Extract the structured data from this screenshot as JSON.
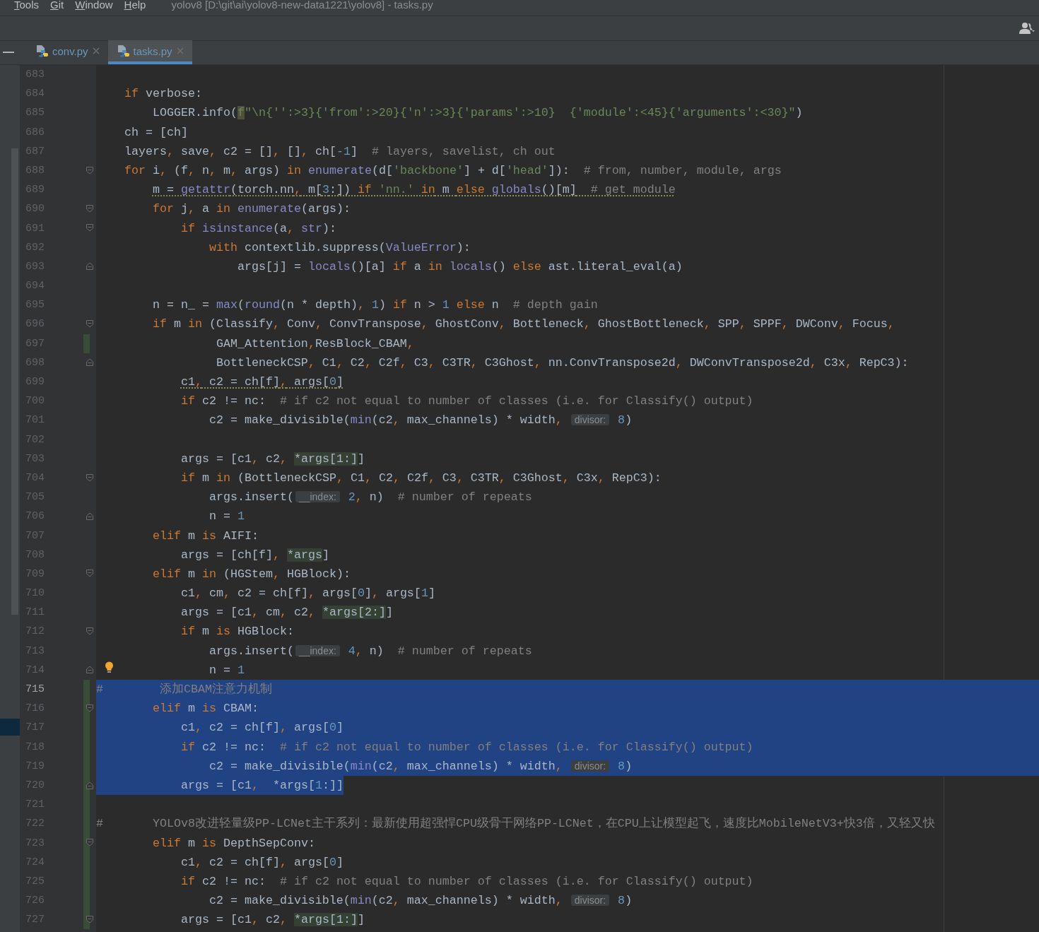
{
  "menu": [
    {
      "label": "Tools"
    },
    {
      "label": "Git"
    },
    {
      "label": "Window"
    },
    {
      "label": "Help"
    }
  ],
  "window": {
    "title": "yolov8 [D:\\git\\ai\\yolov8-new-data1221\\yolov8] - tasks.py"
  },
  "tabs": [
    {
      "label": "conv.py",
      "selected": false
    },
    {
      "label": "tasks.py",
      "selected": true
    }
  ],
  "lines": [
    {
      "number": "683",
      "changed": false,
      "selected": false,
      "current": false
    },
    {
      "number": "684",
      "changed": false,
      "selected": false,
      "current": false,
      "tokens": [
        {
          "kind": "kw",
          "text": "    if"
        },
        {
          "kind": "plain",
          "text": " verbose:"
        }
      ]
    },
    {
      "number": "685",
      "changed": false,
      "selected": false,
      "current": false,
      "tokens": [
        {
          "kind": "plain",
          "text": "        LOGGER.info("
        },
        {
          "kind": "mark",
          "text": "f"
        },
        {
          "kind": "str",
          "text": "\"\\n{'':>3}{'from':>20}{'n':>3}{'params':>10}  {'module':<45}{'arguments':<30}\""
        },
        {
          "kind": "plain",
          "text": ")"
        }
      ]
    },
    {
      "number": "686",
      "changed": false,
      "selected": false,
      "current": false,
      "tokens": [
        {
          "kind": "plain",
          "text": "    ch = [ch]"
        }
      ]
    },
    {
      "number": "687",
      "changed": false,
      "selected": false,
      "current": false,
      "tokens": [
        {
          "kind": "plain",
          "text": "    layers, save, c2 = [], [], ch["
        },
        {
          "kind": "num",
          "text": "-1"
        },
        {
          "kind": "plain",
          "text": "]"
        },
        {
          "kind": "cmt",
          "text": "  # layers, savelist, ch out"
        }
      ]
    },
    {
      "number": "688",
      "changed": false,
      "selected": false,
      "current": false,
      "fold_start": true,
      "tokens": [
        {
          "kind": "kw",
          "text": "    for"
        },
        {
          "kind": "plain",
          "text": " i, (f, n, m, args) "
        },
        {
          "kind": "kw",
          "text": "in"
        },
        {
          "kind": "fn",
          "text": " enumerate"
        },
        {
          "kind": "plain",
          "text": "(d["
        },
        {
          "kind": "str",
          "text": "'backbone'"
        },
        {
          "kind": "plain",
          "text": "] + d["
        },
        {
          "kind": "str",
          "text": "'head'"
        },
        {
          "kind": "plain",
          "text": "]):"
        },
        {
          "kind": "cmt",
          "text": "  # from, number, module, args"
        }
      ]
    },
    {
      "number": "689",
      "changed": false,
      "selected": false,
      "current": false,
      "warning": true,
      "tokens": [
        {
          "kind": "plain",
          "text": "        m = "
        },
        {
          "kind": "fn",
          "text": "getattr"
        },
        {
          "kind": "plain",
          "text": "(torch.nn, m["
        },
        {
          "kind": "num",
          "text": "3"
        },
        {
          "kind": "plain",
          "text": ":]) "
        },
        {
          "kind": "kw",
          "text": "if"
        },
        {
          "kind": "str",
          "text": " 'nn.'"
        },
        {
          "kind": "kw",
          "text": " in"
        },
        {
          "kind": "plain",
          "text": " m "
        },
        {
          "kind": "kw",
          "text": "else"
        },
        {
          "kind": "fn",
          "text": " globals"
        },
        {
          "kind": "plain",
          "text": "()[m]"
        },
        {
          "kind": "cmt",
          "text": "  # get module"
        }
      ]
    },
    {
      "number": "690",
      "changed": false,
      "selected": false,
      "current": false,
      "fold_start": true,
      "tokens": [
        {
          "kind": "kw",
          "text": "        for"
        },
        {
          "kind": "plain",
          "text": " j, a "
        },
        {
          "kind": "kw",
          "text": "in"
        },
        {
          "kind": "fn",
          "text": " enumerate"
        },
        {
          "kind": "plain",
          "text": "(args):"
        }
      ]
    },
    {
      "number": "691",
      "changed": false,
      "selected": false,
      "current": false,
      "fold_start": true,
      "tokens": [
        {
          "kind": "kw",
          "text": "            if"
        },
        {
          "kind": "fn",
          "text": " isinstance"
        },
        {
          "kind": "plain",
          "text": "(a, "
        },
        {
          "kind": "fn",
          "text": "str"
        },
        {
          "kind": "plain",
          "text": "):"
        }
      ]
    },
    {
      "number": "692",
      "changed": false,
      "selected": false,
      "current": false,
      "tokens": [
        {
          "kind": "kw",
          "text": "                with"
        },
        {
          "kind": "plain",
          "text": " contextlib.suppress("
        },
        {
          "kind": "fn",
          "text": "ValueError"
        },
        {
          "kind": "plain",
          "text": "):"
        }
      ]
    },
    {
      "number": "693",
      "changed": false,
      "selected": false,
      "current": false,
      "fold_end": true,
      "tokens": [
        {
          "kind": "plain",
          "text": "                    args[j] = "
        },
        {
          "kind": "fn",
          "text": "locals"
        },
        {
          "kind": "plain",
          "text": "()[a] "
        },
        {
          "kind": "kw",
          "text": "if"
        },
        {
          "kind": "plain",
          "text": " a "
        },
        {
          "kind": "kw",
          "text": "in"
        },
        {
          "kind": "fn",
          "text": " locals"
        },
        {
          "kind": "plain",
          "text": "() "
        },
        {
          "kind": "kw",
          "text": "else"
        },
        {
          "kind": "plain",
          "text": " ast.literal_eval(a)"
        }
      ]
    },
    {
      "number": "694",
      "changed": false,
      "selected": false,
      "current": false
    },
    {
      "number": "695",
      "changed": false,
      "selected": false,
      "current": false,
      "tokens": [
        {
          "kind": "plain",
          "text": "        n = n_ = "
        },
        {
          "kind": "fn",
          "text": "max"
        },
        {
          "kind": "plain",
          "text": "("
        },
        {
          "kind": "fn",
          "text": "round"
        },
        {
          "kind": "plain",
          "text": "(n * depth), "
        },
        {
          "kind": "num",
          "text": "1"
        },
        {
          "kind": "plain",
          "text": ") "
        },
        {
          "kind": "kw",
          "text": "if"
        },
        {
          "kind": "plain",
          "text": " n > "
        },
        {
          "kind": "num",
          "text": "1"
        },
        {
          "kind": "kw",
          "text": " else"
        },
        {
          "kind": "plain",
          "text": " n"
        },
        {
          "kind": "cmt",
          "text": "  # depth gain"
        }
      ]
    },
    {
      "number": "696",
      "changed": false,
      "selected": false,
      "current": false,
      "fold_start": true,
      "tokens": [
        {
          "kind": "kw",
          "text": "        if"
        },
        {
          "kind": "plain",
          "text": " m "
        },
        {
          "kind": "kw",
          "text": "in"
        },
        {
          "kind": "plain",
          "text": " (Classify, Conv, ConvTranspose, GhostConv, Bottleneck, GhostBottleneck, SPP, SPPF, DWConv, Focus,"
        }
      ]
    },
    {
      "number": "697",
      "changed": true,
      "selected": false,
      "current": false,
      "tokens": [
        {
          "kind": "plain",
          "text": "                 GAM_Attention,ResBlock_CBAM,"
        }
      ]
    },
    {
      "number": "698",
      "changed": false,
      "selected": false,
      "current": false,
      "fold_end": true,
      "tokens": [
        {
          "kind": "plain",
          "text": "                 BottleneckCSP, C1, C2, C2f, C3, C3TR, C3Ghost, nn.ConvTranspose2d, DWConvTranspose2d, C3x, RepC3):"
        }
      ]
    },
    {
      "number": "699",
      "changed": false,
      "selected": false,
      "current": false,
      "warning": true,
      "tokens": [
        {
          "kind": "plain",
          "text": "            c1, c2 = ch[f], args["
        },
        {
          "kind": "num",
          "text": "0"
        },
        {
          "kind": "plain",
          "text": "]"
        }
      ]
    },
    {
      "number": "700",
      "changed": false,
      "selected": false,
      "current": false,
      "tokens": [
        {
          "kind": "kw",
          "text": "            if"
        },
        {
          "kind": "plain",
          "text": " c2 != nc:"
        },
        {
          "kind": "cmt",
          "text": "  # if c2 not equal to number of classes (i.e. for Classify() output)"
        }
      ]
    },
    {
      "number": "701",
      "changed": false,
      "selected": false,
      "current": false,
      "tokens": [
        {
          "kind": "plain",
          "text": "                c2 = make_divisible("
        },
        {
          "kind": "fn",
          "text": "min"
        },
        {
          "kind": "plain",
          "text": "(c2, max_channels) * width, "
        },
        {
          "kind": "hint",
          "text": "divisor:"
        },
        {
          "kind": "num",
          "text": " 8"
        },
        {
          "kind": "plain",
          "text": ")"
        }
      ]
    },
    {
      "number": "702",
      "changed": false,
      "selected": false,
      "current": false
    },
    {
      "number": "703",
      "changed": false,
      "selected": false,
      "current": false,
      "tokens": [
        {
          "kind": "plain",
          "text": "            args = [c1, c2, "
        },
        {
          "kind": "use",
          "text": "*args[1:]"
        },
        {
          "kind": "plain",
          "text": "]"
        }
      ]
    },
    {
      "number": "704",
      "changed": false,
      "selected": false,
      "current": false,
      "fold_start": true,
      "tokens": [
        {
          "kind": "kw",
          "text": "            if"
        },
        {
          "kind": "plain",
          "text": " m "
        },
        {
          "kind": "kw",
          "text": "in"
        },
        {
          "kind": "plain",
          "text": " (BottleneckCSP, C1, C2, C2f, C3, C3TR, C3Ghost, C3x, RepC3):"
        }
      ]
    },
    {
      "number": "705",
      "changed": false,
      "selected": false,
      "current": false,
      "tokens": [
        {
          "kind": "plain",
          "text": "                args.insert("
        },
        {
          "kind": "hint",
          "text": "__index:"
        },
        {
          "kind": "num",
          "text": " 2"
        },
        {
          "kind": "plain",
          "text": ", n)"
        },
        {
          "kind": "cmt",
          "text": "  # number of repeats"
        }
      ]
    },
    {
      "number": "706",
      "changed": false,
      "selected": false,
      "current": false,
      "fold_end": true,
      "tokens": [
        {
          "kind": "plain",
          "text": "                n = "
        },
        {
          "kind": "num",
          "text": "1"
        }
      ]
    },
    {
      "number": "707",
      "changed": false,
      "selected": false,
      "current": false,
      "tokens": [
        {
          "kind": "kw",
          "text": "        elif"
        },
        {
          "kind": "plain",
          "text": " m "
        },
        {
          "kind": "kw",
          "text": "is"
        },
        {
          "kind": "plain",
          "text": " AIFI:"
        }
      ]
    },
    {
      "number": "708",
      "changed": false,
      "selected": false,
      "current": false,
      "tokens": [
        {
          "kind": "plain",
          "text": "            args = [ch[f], "
        },
        {
          "kind": "use",
          "text": "*args"
        },
        {
          "kind": "plain",
          "text": "]"
        }
      ]
    },
    {
      "number": "709",
      "changed": false,
      "selected": false,
      "current": false,
      "fold_start": true,
      "tokens": [
        {
          "kind": "kw",
          "text": "        elif"
        },
        {
          "kind": "plain",
          "text": " m "
        },
        {
          "kind": "kw",
          "text": "in"
        },
        {
          "kind": "plain",
          "text": " (HGStem, HGBlock):"
        }
      ]
    },
    {
      "number": "710",
      "changed": false,
      "selected": false,
      "current": false,
      "tokens": [
        {
          "kind": "plain",
          "text": "            c1, cm, c2 = ch[f], args["
        },
        {
          "kind": "num",
          "text": "0"
        },
        {
          "kind": "plain",
          "text": "], args["
        },
        {
          "kind": "num",
          "text": "1"
        },
        {
          "kind": "plain",
          "text": "]"
        }
      ]
    },
    {
      "number": "711",
      "changed": false,
      "selected": false,
      "current": false,
      "tokens": [
        {
          "kind": "plain",
          "text": "            args = [c1, cm, c2, "
        },
        {
          "kind": "use",
          "text": "*args[2:]"
        },
        {
          "kind": "plain",
          "text": "]"
        }
      ]
    },
    {
      "number": "712",
      "changed": false,
      "selected": false,
      "current": false,
      "fold_start": true,
      "tokens": [
        {
          "kind": "kw",
          "text": "            if"
        },
        {
          "kind": "plain",
          "text": " m "
        },
        {
          "kind": "kw",
          "text": "is"
        },
        {
          "kind": "plain",
          "text": " HGBlock:"
        }
      ]
    },
    {
      "number": "713",
      "changed": false,
      "selected": false,
      "current": false,
      "tokens": [
        {
          "kind": "plain",
          "text": "                args.insert("
        },
        {
          "kind": "hint",
          "text": "__index:"
        },
        {
          "kind": "num",
          "text": " 4"
        },
        {
          "kind": "plain",
          "text": ", n)"
        },
        {
          "kind": "cmt",
          "text": "  # number of repeats"
        }
      ]
    },
    {
      "number": "714",
      "changed": false,
      "selected": false,
      "current": false,
      "fold_end": true,
      "bulb": true,
      "tokens": [
        {
          "kind": "plain",
          "text": "                n = "
        },
        {
          "kind": "num",
          "text": "1"
        }
      ]
    },
    {
      "number": "715",
      "changed": true,
      "selected": true,
      "current": true,
      "tokens": [
        {
          "kind": "cmt",
          "text": "#        添加CBAM注意力机制"
        }
      ]
    },
    {
      "number": "716",
      "changed": true,
      "selected": true,
      "current": false,
      "fold_start": true,
      "tokens": [
        {
          "kind": "kw",
          "text": "        elif"
        },
        {
          "kind": "plain",
          "text": " m "
        },
        {
          "kind": "kw",
          "text": "is"
        },
        {
          "kind": "plain",
          "text": " CBAM:"
        }
      ]
    },
    {
      "number": "717",
      "changed": true,
      "selected": true,
      "current": false,
      "tokens": [
        {
          "kind": "plain",
          "text": "            c1, c2 = ch[f], args["
        },
        {
          "kind": "num",
          "text": "0"
        },
        {
          "kind": "plain",
          "text": "]"
        }
      ]
    },
    {
      "number": "718",
      "changed": true,
      "selected": true,
      "current": false,
      "tokens": [
        {
          "kind": "kw",
          "text": "            if"
        },
        {
          "kind": "plain",
          "text": " c2 != nc:"
        },
        {
          "kind": "cmt",
          "text": "  # if c2 not equal to number of classes (i.e. for Classify() output)"
        }
      ]
    },
    {
      "number": "719",
      "changed": true,
      "selected": true,
      "current": false,
      "tokens": [
        {
          "kind": "plain",
          "text": "                c2 = make_divisible("
        },
        {
          "kind": "fn",
          "text": "min"
        },
        {
          "kind": "plain",
          "text": "(c2, max_channels) * width, "
        },
        {
          "kind": "hint",
          "text": "divisor:"
        },
        {
          "kind": "num",
          "text": " 8"
        },
        {
          "kind": "plain",
          "text": ")"
        }
      ]
    },
    {
      "number": "720",
      "changed": true,
      "selected": true,
      "current": false,
      "fold_end": true,
      "tokens": [
        {
          "kind": "plain",
          "text": "            args = [c1,  *args["
        },
        {
          "kind": "num",
          "text": "1"
        },
        {
          "kind": "plain",
          "text": ":]]"
        }
      ]
    },
    {
      "number": "721",
      "changed": true,
      "selected": false,
      "current": false
    },
    {
      "number": "722",
      "changed": true,
      "selected": false,
      "current": false,
      "tokens": [
        {
          "kind": "cmt",
          "text": "#       YOLOv8改进轻量级PP-LCNet主干系列：最新使用超强悍CPU级骨干网络PP-LCNet，在CPU上让模型起飞，速度比MobileNetV3+快3倍，又轻又快"
        }
      ]
    },
    {
      "number": "723",
      "changed": true,
      "selected": false,
      "current": false,
      "fold_start": true,
      "tokens": [
        {
          "kind": "kw",
          "text": "        elif"
        },
        {
          "kind": "plain",
          "text": " m "
        },
        {
          "kind": "kw",
          "text": "is"
        },
        {
          "kind": "plain",
          "text": " DepthSepConv:"
        }
      ]
    },
    {
      "number": "724",
      "changed": true,
      "selected": false,
      "current": false,
      "tokens": [
        {
          "kind": "plain",
          "text": "            c1, c2 = ch[f], args["
        },
        {
          "kind": "num",
          "text": "0"
        },
        {
          "kind": "plain",
          "text": "]"
        }
      ]
    },
    {
      "number": "725",
      "changed": true,
      "selected": false,
      "current": false,
      "tokens": [
        {
          "kind": "kw",
          "text": "            if"
        },
        {
          "kind": "plain",
          "text": " c2 != nc:"
        },
        {
          "kind": "cmt",
          "text": "  # if c2 not equal to number of classes (i.e. for Classify() output)"
        }
      ]
    },
    {
      "number": "726",
      "changed": true,
      "selected": false,
      "current": false,
      "tokens": [
        {
          "kind": "plain",
          "text": "                c2 = make_divisible("
        },
        {
          "kind": "fn",
          "text": "min"
        },
        {
          "kind": "plain",
          "text": "(c2, max_channels) * width, "
        },
        {
          "kind": "hint",
          "text": "divisor:"
        },
        {
          "kind": "num",
          "text": " 8"
        },
        {
          "kind": "plain",
          "text": ")"
        }
      ]
    },
    {
      "number": "727",
      "changed": true,
      "selected": false,
      "current": false,
      "fold_start": true,
      "tokens": [
        {
          "kind": "plain",
          "text": "            args = [c1, c2, "
        },
        {
          "kind": "use",
          "text": "*args[1:]"
        },
        {
          "kind": "plain",
          "text": "]"
        }
      ]
    }
  ]
}
